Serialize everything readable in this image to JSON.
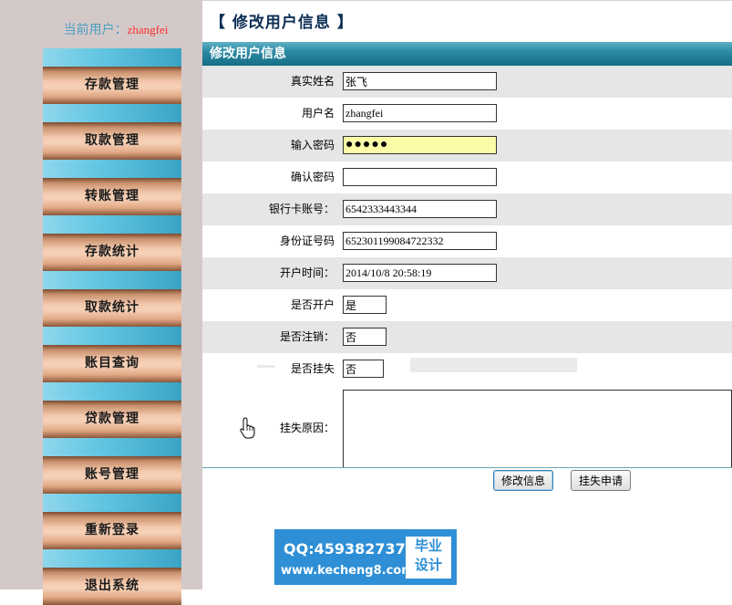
{
  "sidebar": {
    "current_user_label": "当前用户：",
    "current_user_name": "zhangfei",
    "menu": [
      {
        "label": "存款管理"
      },
      {
        "label": "取款管理"
      },
      {
        "label": "转账管理"
      },
      {
        "label": "存款统计"
      },
      {
        "label": "取款统计"
      },
      {
        "label": "账目查询"
      },
      {
        "label": "贷款管理"
      },
      {
        "label": "账号管理"
      },
      {
        "label": "重新登录"
      },
      {
        "label": "退出系统"
      }
    ]
  },
  "main": {
    "page_title": "【 修改用户信息 】",
    "section_title": "修改用户信息",
    "fields": {
      "real_name": {
        "label": "真实姓名",
        "value": "张飞"
      },
      "username": {
        "label": "用户名",
        "value": "zhangfei"
      },
      "password": {
        "label": "输入密码",
        "value": "●●●●●"
      },
      "confirm_password": {
        "label": "确认密码",
        "value": ""
      },
      "bank_card": {
        "label": "银行卡账号：",
        "value": "6542333443344"
      },
      "id_number": {
        "label": "身份证号码",
        "value": "652301199084722332"
      },
      "open_time": {
        "label": "开户时间：",
        "value": "2014/10/8 20:58:19"
      },
      "is_opened": {
        "label": "是否开户",
        "value": "是"
      },
      "is_cancelled": {
        "label": "是否注销：",
        "value": "否"
      },
      "is_lost": {
        "label": "是否挂失",
        "value": "否"
      },
      "lost_reason": {
        "label": "挂失原因：",
        "value": ""
      }
    },
    "buttons": {
      "modify": "修改信息",
      "report_loss": "挂失申请"
    }
  },
  "watermark": {
    "qq": "QQ:459382737",
    "site": "www.kecheng8.com",
    "badge_line1": "毕业",
    "badge_line2": "设计"
  },
  "colors": {
    "sidebar_bg": "#d4c9c9",
    "header_accent": "#166d86",
    "username_red": "#ff2a2a",
    "password_highlight": "#fbfba8",
    "watermark_blue": "#2e8fd6"
  }
}
